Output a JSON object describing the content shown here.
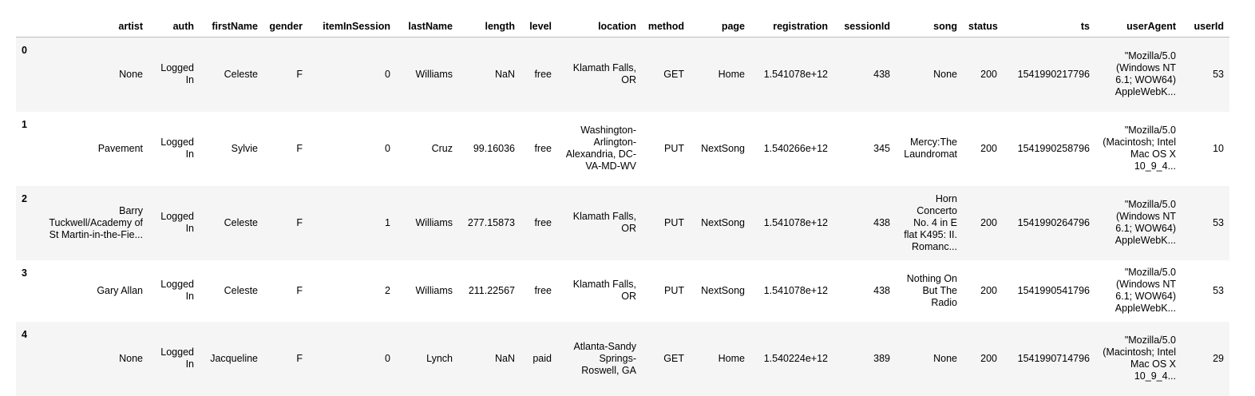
{
  "dataframe": {
    "columns": [
      "artist",
      "auth",
      "firstName",
      "gender",
      "itemInSession",
      "lastName",
      "length",
      "level",
      "location",
      "method",
      "page",
      "registration",
      "sessionId",
      "song",
      "status",
      "ts",
      "userAgent",
      "userId"
    ],
    "rows": [
      {
        "index": "0",
        "artist": "None",
        "auth": "Logged In",
        "firstName": "Celeste",
        "gender": "F",
        "itemInSession": "0",
        "lastName": "Williams",
        "length": "NaN",
        "level": "free",
        "location": "Klamath Falls, OR",
        "method": "GET",
        "page": "Home",
        "registration": "1.541078e+12",
        "sessionId": "438",
        "song": "None",
        "status": "200",
        "ts": "1541990217796",
        "userAgent": "\"Mozilla/5.0 (Windows NT 6.1; WOW64) AppleWebK...",
        "userId": "53"
      },
      {
        "index": "1",
        "artist": "Pavement",
        "auth": "Logged In",
        "firstName": "Sylvie",
        "gender": "F",
        "itemInSession": "0",
        "lastName": "Cruz",
        "length": "99.16036",
        "level": "free",
        "location": "Washington-Arlington-Alexandria, DC-VA-MD-WV",
        "method": "PUT",
        "page": "NextSong",
        "registration": "1.540266e+12",
        "sessionId": "345",
        "song": "Mercy:The Laundromat",
        "status": "200",
        "ts": "1541990258796",
        "userAgent": "\"Mozilla/5.0 (Macintosh; Intel Mac OS X 10_9_4...",
        "userId": "10"
      },
      {
        "index": "2",
        "artist": "Barry Tuckwell/Academy of St Martin-in-the-Fie...",
        "auth": "Logged In",
        "firstName": "Celeste",
        "gender": "F",
        "itemInSession": "1",
        "lastName": "Williams",
        "length": "277.15873",
        "level": "free",
        "location": "Klamath Falls, OR",
        "method": "PUT",
        "page": "NextSong",
        "registration": "1.541078e+12",
        "sessionId": "438",
        "song": "Horn Concerto No. 4 in E flat K495: II. Romanc...",
        "status": "200",
        "ts": "1541990264796",
        "userAgent": "\"Mozilla/5.0 (Windows NT 6.1; WOW64) AppleWebK...",
        "userId": "53"
      },
      {
        "index": "3",
        "artist": "Gary Allan",
        "auth": "Logged In",
        "firstName": "Celeste",
        "gender": "F",
        "itemInSession": "2",
        "lastName": "Williams",
        "length": "211.22567",
        "level": "free",
        "location": "Klamath Falls, OR",
        "method": "PUT",
        "page": "NextSong",
        "registration": "1.541078e+12",
        "sessionId": "438",
        "song": "Nothing On But The Radio",
        "status": "200",
        "ts": "1541990541796",
        "userAgent": "\"Mozilla/5.0 (Windows NT 6.1; WOW64) AppleWebK...",
        "userId": "53"
      },
      {
        "index": "4",
        "artist": "None",
        "auth": "Logged In",
        "firstName": "Jacqueline",
        "gender": "F",
        "itemInSession": "0",
        "lastName": "Lynch",
        "length": "NaN",
        "level": "paid",
        "location": "Atlanta-Sandy Springs-Roswell, GA",
        "method": "GET",
        "page": "Home",
        "registration": "1.540224e+12",
        "sessionId": "389",
        "song": "None",
        "status": "200",
        "ts": "1541990714796",
        "userAgent": "\"Mozilla/5.0 (Macintosh; Intel Mac OS X 10_9_4...",
        "userId": "29"
      }
    ]
  }
}
